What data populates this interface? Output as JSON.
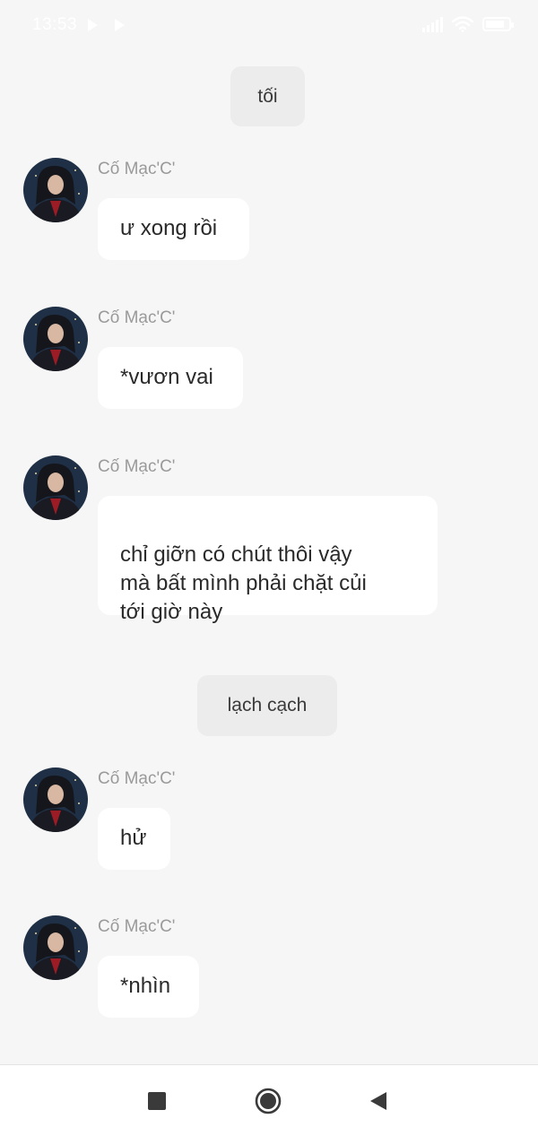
{
  "status_bar": {
    "time": "13:53",
    "icons": [
      "play-icon",
      "play-icon",
      "signal-icon",
      "wifi-icon",
      "battery-icon"
    ],
    "battery_level": 0.85
  },
  "colors": {
    "background": "#f6f6f6",
    "bubble": "#ffffff",
    "system_pill": "#ececec",
    "sender_name": "#9a9a9a",
    "message_text": "#2a2a2a"
  },
  "chat": {
    "system_1": "tối",
    "messages": [
      {
        "sender": "Cố Mạc'C'",
        "text": "ư xong rồi"
      },
      {
        "sender": "Cố Mạc'C'",
        "text": "*vươn vai"
      },
      {
        "sender": "Cố Mạc'C'",
        "text": "chỉ giỡn có chút thôi vậy\nmà bất mình phải chặt củi\ntới giờ này"
      },
      {
        "sender": "Cố Mạc'C'",
        "text": "hử"
      },
      {
        "sender": "Cố Mạc'C'",
        "text": "*nhìn"
      }
    ],
    "system_2": "lạch cạch"
  },
  "nav_bar": {
    "buttons": [
      "recents-square-icon",
      "home-circle-icon",
      "back-triangle-icon"
    ]
  }
}
